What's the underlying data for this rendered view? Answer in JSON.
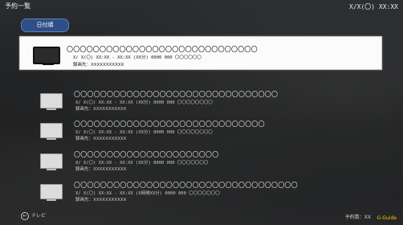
{
  "header": {
    "title": "予約一覧",
    "clock": "X/X(〇) XX:XX"
  },
  "sort_button": {
    "label": "日付順"
  },
  "items": [
    {
      "name": "〇〇〇〇〇〇〇〇〇〇〇〇〇〇〇〇〇〇〇〇〇〇〇〇〇〇〇〇〇",
      "info": "X/ X(〇) XX:XX - XX:XX (XX分) 0000 000 〇〇〇〇〇〇",
      "dest": "録画先：XXXXXXXXXXX"
    },
    {
      "name": "〇〇〇〇〇〇〇〇〇〇〇〇〇〇〇〇〇〇〇〇〇〇〇〇〇〇〇〇〇〇〇",
      "info": "X/ X(〇) XX:XX - XX:XX (XX分) 0000 000 〇〇〇〇〇〇〇〇",
      "dest": "録画先：XXXXXXXXXXX"
    },
    {
      "name": "〇〇〇〇〇〇〇〇〇〇〇〇〇〇〇〇〇〇〇〇〇〇〇〇〇〇〇〇〇",
      "info": "X/ X(〇) XX:XX - XX:XX (XX分) 0000 000 〇〇〇〇〇〇〇〇",
      "dest": "録画先：XXXXXXXXXXX"
    },
    {
      "name": "〇〇〇〇〇〇〇〇〇〇〇〇〇〇〇〇〇〇〇〇〇〇",
      "info": "X/ X(〇) XX:XX - XX:XX (XX分) 0000 000 〇〇〇〇〇〇〇",
      "dest": "録画先：XXXXXXXXXXX"
    },
    {
      "name": "〇〇〇〇〇〇〇〇〇〇〇〇〇〇〇〇〇〇〇〇〇〇〇〇〇〇〇〇〇〇〇〇〇〇",
      "info": "X/ X(〇) XX:XX - XX:XX (X時間XX分) 0000 000 〇〇〇〇〇〇〇",
      "dest": "録画先：XXXXXXXXXXX"
    }
  ],
  "footer": {
    "back_icon": "left-arrow-circle-icon",
    "back_label": "テレビ",
    "count": "予約数：XX",
    "logo": "G-Guide"
  },
  "colors": {
    "accent": "#2f4f88",
    "selected_bg": "#fbfbfb",
    "logo": "#ffcc00"
  }
}
